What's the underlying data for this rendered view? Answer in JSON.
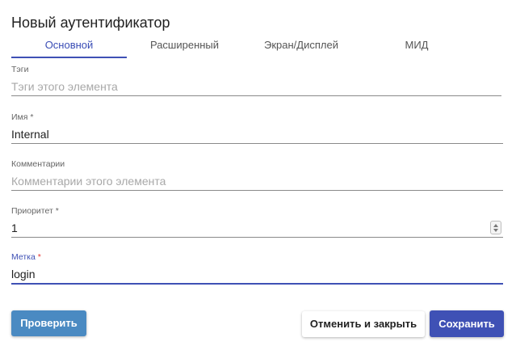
{
  "dialog": {
    "title": "Новый аутентификатор"
  },
  "tabs": [
    {
      "label": "Основной",
      "active": true
    },
    {
      "label": "Расширенный",
      "active": false
    },
    {
      "label": "Экран/Дисплей",
      "active": false
    },
    {
      "label": "МИД",
      "active": false
    }
  ],
  "fields": {
    "tags": {
      "label": "Тэги",
      "value": "",
      "placeholder": "Тэги этого элемента"
    },
    "name": {
      "label": "Имя",
      "required_mark": "*",
      "value": "Internal"
    },
    "comments": {
      "label": "Комментарии",
      "value": "",
      "placeholder": "Комментарии этого элемента"
    },
    "priority": {
      "label": "Приоритет",
      "required_mark": "*",
      "value": "1"
    },
    "tag": {
      "label": "Метка",
      "required_mark": "*",
      "value": "login"
    }
  },
  "buttons": {
    "test": "Проверить",
    "cancel": "Отменить и закрыть",
    "save": "Сохранить"
  },
  "colors": {
    "accent": "#3f51b5",
    "test_button": "#4a8ac2",
    "required_focused": "#e53935"
  }
}
